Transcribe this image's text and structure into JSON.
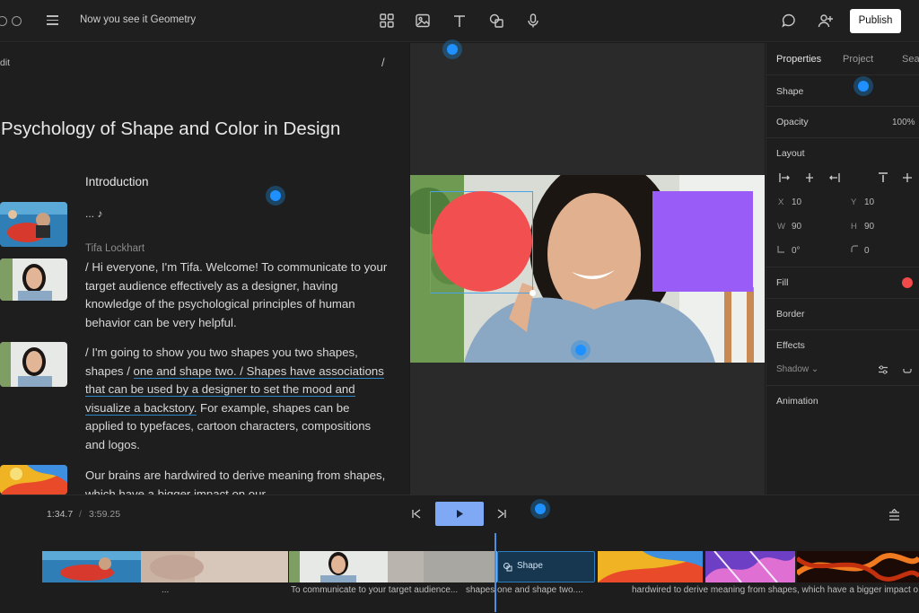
{
  "app": {
    "doc_title": "Now you see it Geometry",
    "publish_label": "Publish"
  },
  "toolbar": {
    "tools": [
      "grid-icon",
      "image-icon",
      "text-icon",
      "shapes-icon",
      "microphone-icon"
    ],
    "right_icons": [
      "comment-icon",
      "add-user-icon"
    ]
  },
  "script": {
    "edit_label": "dit",
    "slash": "/",
    "title": "Psychology of Shape and Color in Design",
    "section_heading": "Introduction",
    "ellipsis": "... ♪",
    "speaker": "Tifa Lockhart",
    "para1": "/ Hi everyone, I'm Tifa. Welcome! To communicate to your target audience effectively as a designer, having knowledge of the psychological principles of human behavior can be very helpful.",
    "para2_a": "/ I'm going to show you two shapes you two shapes, shapes / ",
    "para2_hl": "one and shape two. / Shapes have associations that can be used by a designer to set the mood and visualize a backstory.",
    "para2_b": " For example, shapes can be applied to typefaces, cartoon characters, compositions and logos.",
    "para3": "Our brains are hardwired to derive meaning from shapes, which have a bigger impact on our"
  },
  "properties": {
    "tabs": [
      "Properties",
      "Project",
      "Sea"
    ],
    "shape_label": "Shape",
    "opacity_label": "Opacity",
    "opacity_value": "100%",
    "layout_label": "Layout",
    "x_key": "X",
    "x_value": "10",
    "y_key": "Y",
    "y_value": "10",
    "w_key": "W",
    "w_value": "90",
    "h_key": "H",
    "h_value": "90",
    "rotation_value": "0°",
    "radius_value": "0",
    "fill_label": "Fill",
    "fill_color": "#f04a4a",
    "border_label": "Border",
    "effects_label": "Effects",
    "shadow_label": "Shadow ⌄",
    "animation_label": "Animation"
  },
  "canvas": {
    "circle_color": "#f25050",
    "square_color": "#9a5cf6"
  },
  "timeline": {
    "current_time": "1:34.7",
    "separator": "/",
    "total_time": "3:59.25",
    "shape_clip_label": "Shape",
    "captions": [
      "...",
      "To communicate to your target audience...",
      "shapes one and shape two....",
      "hardwired to derive meaning from shapes, which have a bigger impact o"
    ]
  }
}
